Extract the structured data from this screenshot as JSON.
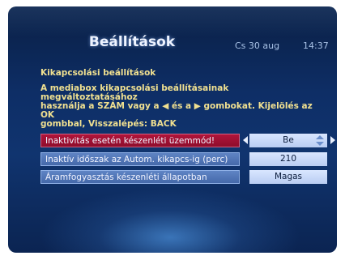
{
  "header": {
    "title": "Beállítások",
    "date": "Cs 30 aug",
    "time": "14:37"
  },
  "section_title": "Kikapcsolási beállítások",
  "help_lines": [
    "A mediabox kikapcsolási beállításainak megváltoztatásához",
    "használja a SZÁM vagy a ◀ és a ▶ gombokat. Kijelölés az OK",
    "gombbal, Visszalépés: BACK"
  ],
  "settings": [
    {
      "label": "Inaktivitás esetén készenléti üzemmód!",
      "value": "Be",
      "selected": true
    },
    {
      "label": "Inaktív időszak az Autom. kikapcs-ig (perc)",
      "value": "210",
      "selected": false
    },
    {
      "label": "Áramfogyasztás készenléti állapotban",
      "value": "Magas",
      "selected": false
    }
  ],
  "colors": {
    "selected_row": "#a1123a",
    "row": "#5578b8",
    "value_box": "#c9d9f7",
    "help_text": "#f0e090"
  }
}
